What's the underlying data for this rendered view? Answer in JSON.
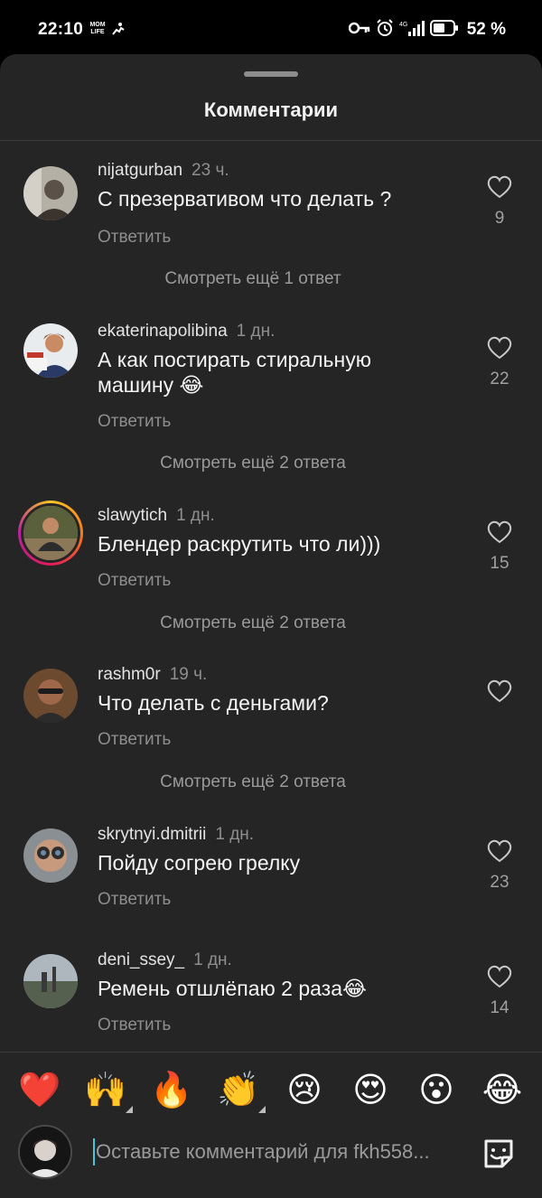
{
  "status_bar": {
    "time": "22:10",
    "tiny_label_top": "MOM",
    "tiny_label_bottom": "LIFE",
    "battery": "52 %"
  },
  "sheet": {
    "title": "Комментарии"
  },
  "comments": [
    {
      "user": "nijatgurban",
      "time": "23 ч.",
      "text": "С презервативом что делать ?",
      "reply": "Ответить",
      "likes": "9",
      "more": "Смотреть ещё 1 ответ"
    },
    {
      "user": "ekaterinapolibina",
      "time": "1 дн.",
      "text": "А как постирать стиральную машину 😂",
      "reply": "Ответить",
      "likes": "22",
      "more": "Смотреть ещё 2 ответа"
    },
    {
      "user": "slawytich",
      "time": "1 дн.",
      "text": "Блендер раскрутить что ли)))",
      "reply": "Ответить",
      "likes": "15",
      "more": "Смотреть ещё 2 ответа"
    },
    {
      "user": "rashm0r",
      "time": "19 ч.",
      "text": "Что делать с деньгами?",
      "reply": "Ответить",
      "likes": "",
      "more": "Смотреть ещё 2 ответа"
    },
    {
      "user": "skrytnyi.dmitrii",
      "time": "1 дн.",
      "text": "Пойду согрею грелку",
      "reply": "Ответить",
      "likes": "23"
    },
    {
      "user": "deni_ssey_",
      "time": "1 дн.",
      "text": "Ремень отшлёпаю 2 раза😂",
      "reply": "Ответить",
      "likes": "14"
    }
  ],
  "emojis": [
    "❤️",
    "🙌",
    "🔥",
    "👏",
    "😢",
    "😍",
    "😮",
    "😂"
  ],
  "composer": {
    "placeholder": "Оставьте комментарий для fkh558..."
  },
  "colors": {
    "sheet_bg": "#252525",
    "muted_text": "#8e8e8e",
    "caret": "#47c7d6"
  },
  "icons": {
    "like": "heart-outline-icon",
    "sticker": "sticker-smile-icon",
    "alarm": "alarm-icon",
    "key": "key-icon",
    "battery": "battery-icon",
    "signal": "signal-icon"
  }
}
